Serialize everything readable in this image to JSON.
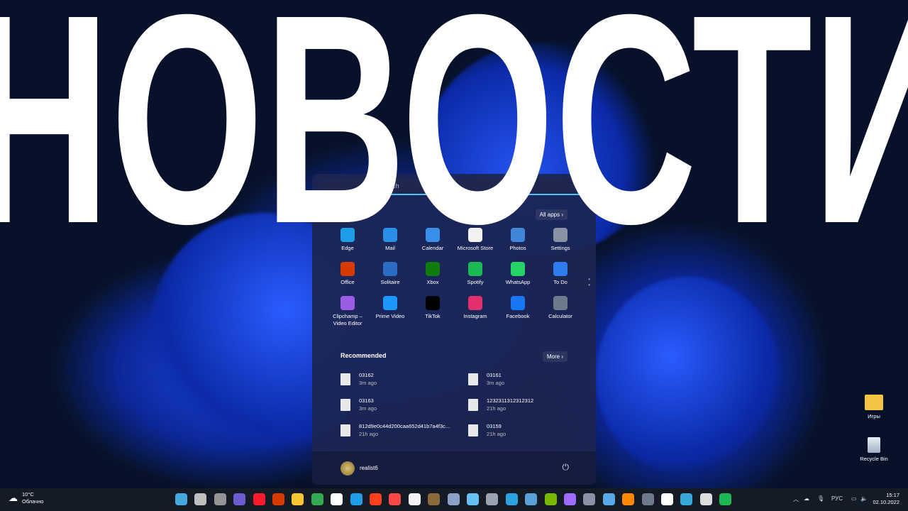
{
  "headline": "НОВОСТИ",
  "start_menu": {
    "search_placeholder": "Search",
    "all_apps": "All apps",
    "pinned": [
      {
        "label": "Edge",
        "icon": "edge-icon",
        "color": "#1e9de8"
      },
      {
        "label": "Mail",
        "icon": "mail-icon",
        "color": "#2a8ee6"
      },
      {
        "label": "Calendar",
        "icon": "calendar-icon",
        "color": "#3a8fe8"
      },
      {
        "label": "Microsoft Store",
        "icon": "store-icon",
        "color": "#f2f2f2"
      },
      {
        "label": "Photos",
        "icon": "photos-icon",
        "color": "#3f86d8"
      },
      {
        "label": "Settings",
        "icon": "gear-icon",
        "color": "#8a93a6"
      },
      {
        "label": "Office",
        "icon": "office-icon",
        "color": "#d83b01"
      },
      {
        "label": "Solitaire",
        "icon": "solitaire-icon",
        "color": "#2b6cc4"
      },
      {
        "label": "Xbox",
        "icon": "xbox-icon",
        "color": "#107c10"
      },
      {
        "label": "Spotify",
        "icon": "spotify-icon",
        "color": "#1db954"
      },
      {
        "label": "WhatsApp",
        "icon": "whatsapp-icon",
        "color": "#25d366"
      },
      {
        "label": "To Do",
        "icon": "todo-icon",
        "color": "#2f7bf0"
      },
      {
        "label": "Clipchamp – Video Editor",
        "icon": "clipchamp-icon",
        "color": "#9b5de5"
      },
      {
        "label": "Prime Video",
        "icon": "prime-video-icon",
        "color": "#1a98ff"
      },
      {
        "label": "TikTok",
        "icon": "tiktok-icon",
        "color": "#000000"
      },
      {
        "label": "Instagram",
        "icon": "instagram-icon",
        "color": "#e1306c"
      },
      {
        "label": "Facebook",
        "icon": "facebook-icon",
        "color": "#1877f2"
      },
      {
        "label": "Calculator",
        "icon": "calculator-icon",
        "color": "#6d7a8c"
      }
    ],
    "recommended_title": "Recommended",
    "more": "More",
    "recommended": [
      {
        "name": "03162",
        "time": "3m ago"
      },
      {
        "name": "03161",
        "time": "3m ago"
      },
      {
        "name": "03163",
        "time": "3m ago"
      },
      {
        "name": "1232311312312312",
        "time": "21h ago"
      },
      {
        "name": "812d9e0c44d200caa652d41b7a4f3c...",
        "time": "21h ago"
      },
      {
        "name": "03159",
        "time": "21h ago"
      }
    ],
    "user": "realist6"
  },
  "desktop": {
    "icons": [
      {
        "label": "Игры",
        "icon": "folder-icon"
      },
      {
        "label": "Recycle Bin",
        "icon": "recycle-bin-icon"
      }
    ]
  },
  "taskbar": {
    "weather": {
      "temp": "10°C",
      "condition": "Облачно"
    },
    "apps": [
      {
        "name": "start",
        "color": "#4cc2ff"
      },
      {
        "name": "search",
        "color": "#dddddd"
      },
      {
        "name": "task-view",
        "color": "#aaaaaa"
      },
      {
        "name": "chat",
        "color": "#7b68ee"
      },
      {
        "name": "opera",
        "color": "#ff1b2d"
      },
      {
        "name": "office",
        "color": "#d83b01"
      },
      {
        "name": "file-explorer",
        "color": "#f8c630"
      },
      {
        "name": "chrome",
        "color": "#34a853"
      },
      {
        "name": "yandex-browser",
        "color": "#ffffff"
      },
      {
        "name": "edge",
        "color": "#1e9de8"
      },
      {
        "name": "yandex",
        "color": "#fc3f1d"
      },
      {
        "name": "ea",
        "color": "#ff4747"
      },
      {
        "name": "store",
        "color": "#f2f2f2"
      },
      {
        "name": "game",
        "color": "#8a6a3a"
      },
      {
        "name": "app",
        "color": "#8ca0c8"
      },
      {
        "name": "steam",
        "color": "#66c0f4"
      },
      {
        "name": "camera",
        "color": "#9aa3b0"
      },
      {
        "name": "telegram",
        "color": "#2aa3df"
      },
      {
        "name": "remote-desktop",
        "color": "#5aa0d8"
      },
      {
        "name": "nvidia",
        "color": "#76b900"
      },
      {
        "name": "alice",
        "color": "#9b6cff"
      },
      {
        "name": "settings",
        "color": "#8a93a6"
      },
      {
        "name": "notepad",
        "color": "#5aa8e6"
      },
      {
        "name": "vlc",
        "color": "#ff8800"
      },
      {
        "name": "calculator",
        "color": "#6d7a8c"
      },
      {
        "name": "logitech-g",
        "color": "#ffffff"
      },
      {
        "name": "app-2",
        "color": "#38a8d8"
      },
      {
        "name": "2k",
        "color": "#dddddd"
      },
      {
        "name": "spotify",
        "color": "#1db954"
      }
    ],
    "language": "РУС",
    "time": "15:17",
    "date": "02.10.2022"
  }
}
